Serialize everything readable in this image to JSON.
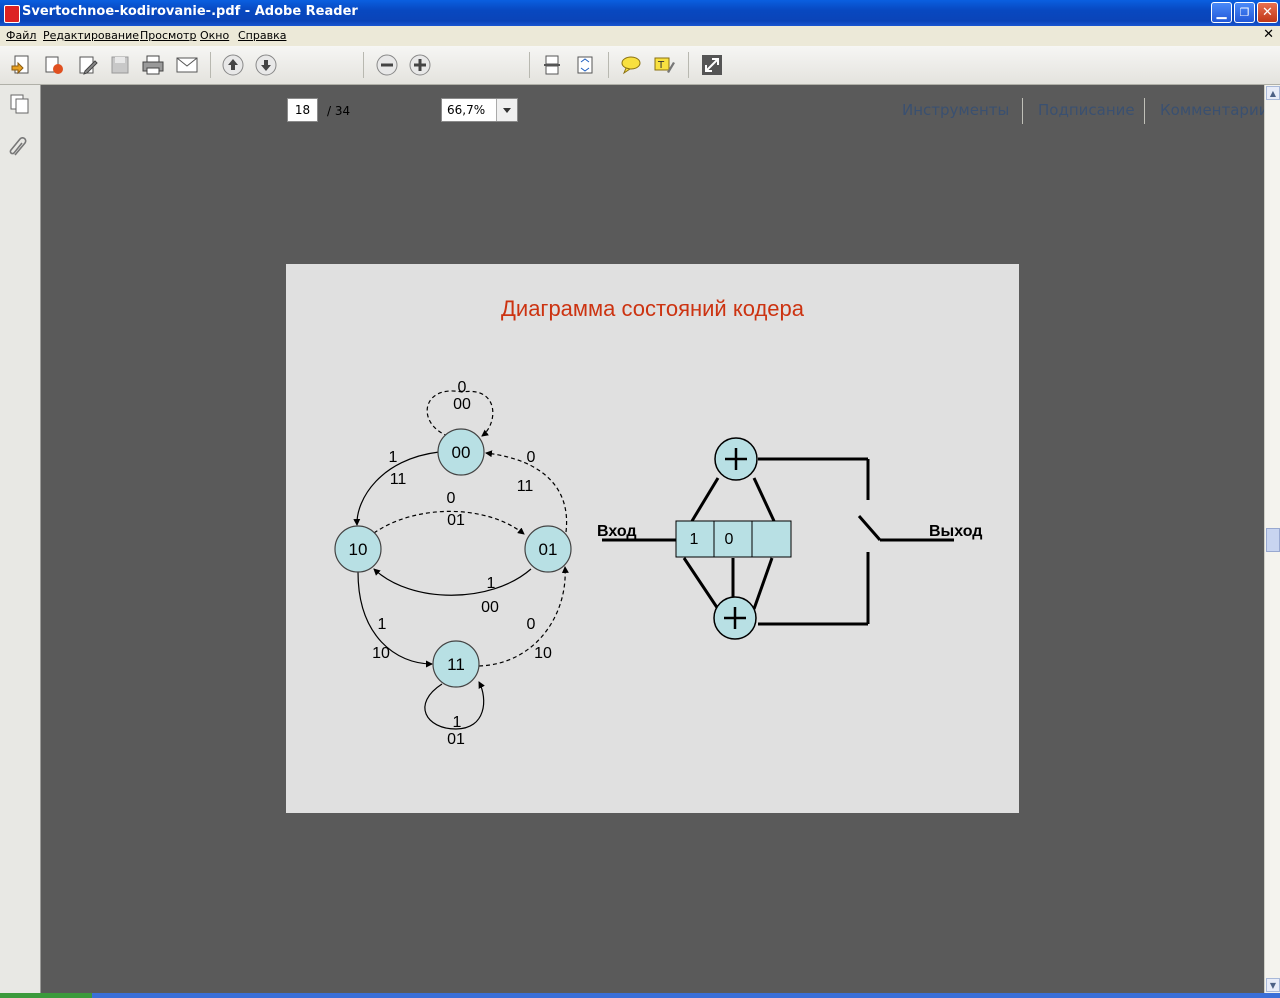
{
  "window": {
    "title": "Svertochnoe-kodirovanie-.pdf - Adobe Reader"
  },
  "menu": [
    "Файл",
    "Редактирование",
    "Просмотр",
    "Окно",
    "Справка"
  ],
  "toolbar": {
    "page_current": "18",
    "page_total": "/  34",
    "zoom": "66,7%",
    "links": {
      "tools": "Инструменты",
      "sign": "Подписание",
      "comments": "Комментарии"
    }
  },
  "slide": {
    "title": "Диаграмма состояний кодера",
    "states": [
      "00",
      "10",
      "01",
      "11"
    ],
    "transitions": {
      "s00_self": {
        "input": "0",
        "output": "00"
      },
      "s00_to_10": {
        "input": "1",
        "output": "11"
      },
      "s01_to_00": {
        "input": "0",
        "output": "11"
      },
      "s10_to_01": {
        "input": "0",
        "output": "01"
      },
      "s01_to_10": {
        "input": "1",
        "output": "00"
      },
      "s10_to_11": {
        "input": "1",
        "output": "10"
      },
      "s11_to_01": {
        "input": "0",
        "output": "10"
      },
      "s11_self": {
        "input": "1",
        "output": "01"
      }
    },
    "encoder": {
      "input_label": "Вход",
      "output_label": "Выход",
      "register": [
        "1",
        "0",
        ""
      ]
    }
  }
}
